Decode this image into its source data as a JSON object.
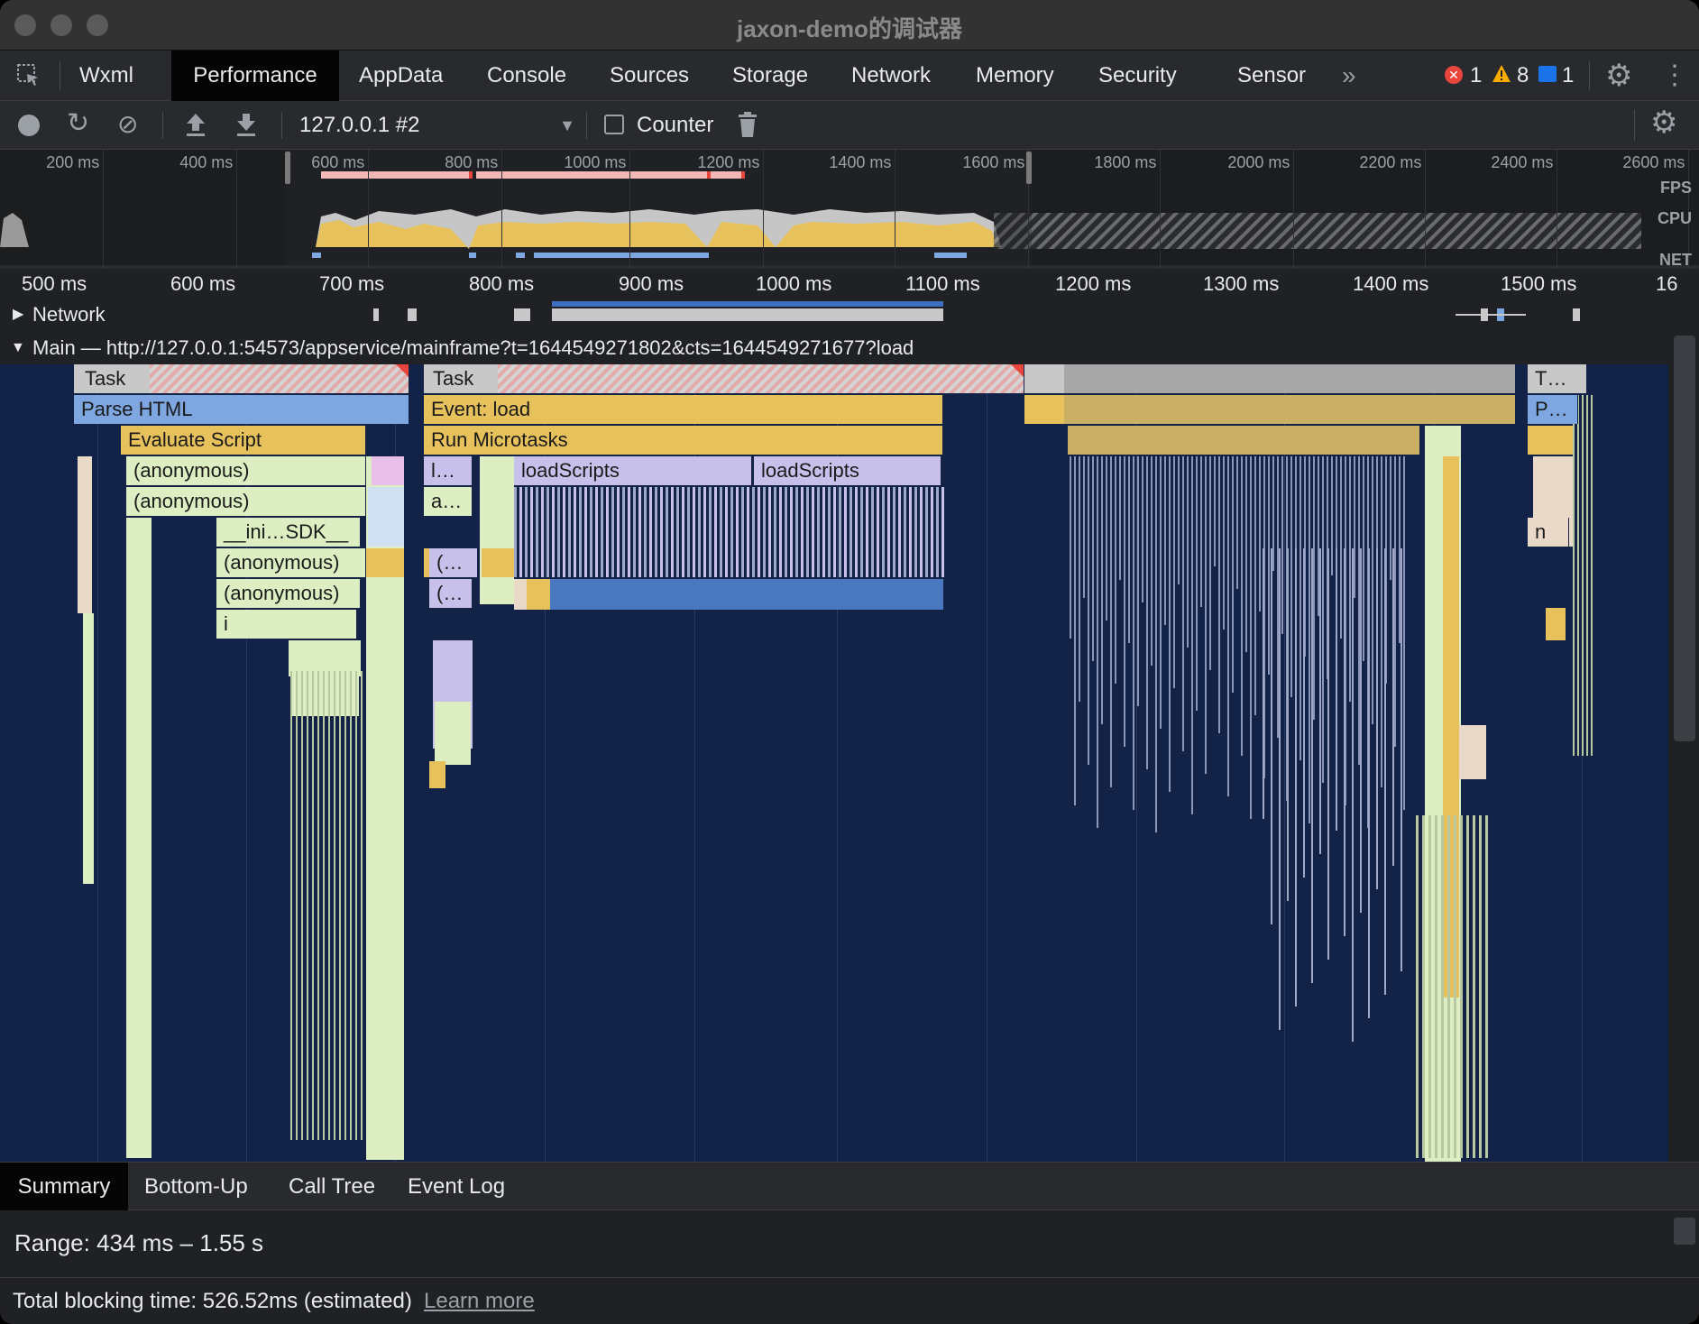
{
  "window": {
    "title": "jaxon-demo的调试器"
  },
  "tabs": [
    "Wxml",
    "Performance",
    "AppData",
    "Console",
    "Sources",
    "Storage",
    "Network",
    "Memory",
    "Security",
    "Sensor"
  ],
  "active_tab": "Performance",
  "more_tabs_label": "»",
  "counts": {
    "errors": "1",
    "warnings": "8",
    "messages": "1"
  },
  "toolbar": {
    "target": "127.0.0.1 #2",
    "counter_label": "Counter"
  },
  "overview": {
    "ticks": [
      "200 ms",
      "400 ms",
      "600 ms",
      "800 ms",
      "1000 ms",
      "1200 ms",
      "1400 ms",
      "1600 ms",
      "1800 ms",
      "2000 ms",
      "2200 ms",
      "2400 ms",
      "2600 ms"
    ],
    "fps_label": "FPS",
    "cpu_label": "CPU",
    "net_label": "NET"
  },
  "ruler": {
    "ticks": [
      "500 ms",
      "600 ms",
      "700 ms",
      "800 ms",
      "900 ms",
      "1000 ms",
      "1100 ms",
      "1200 ms",
      "1300 ms",
      "1400 ms",
      "1500 ms",
      "16"
    ]
  },
  "tracks": {
    "network_label": "Network",
    "main_label": "Main — http://127.0.0.1:54573/appservice/mainframe?t=1644549271802&cts=1644549271677?load"
  },
  "flame": {
    "task1": "Task",
    "task2": "Task",
    "task3": "T…",
    "parse_html": "Parse HTML",
    "event_load": "Event: load",
    "p_short": "P…",
    "evaluate_script": "Evaluate Script",
    "run_microtasks": "Run Microtasks",
    "anon1": "(anonymous)",
    "anon2": "(anonymous)",
    "anon3": "(anonymous)",
    "anon4": "(anonymous)",
    "init_sdk": "__ini…SDK__",
    "fn_i": "i",
    "l_short": "l…",
    "a_short": "a…",
    "paren1": "(…",
    "paren2": "(…",
    "load_scripts1": "loadScripts",
    "load_scripts2": "loadScripts",
    "fn_n": "n"
  },
  "bottom_tabs": [
    "Summary",
    "Bottom-Up",
    "Call Tree",
    "Event Log"
  ],
  "active_bottom_tab": "Summary",
  "summary": {
    "range": "Range: 434 ms – 1.55 s"
  },
  "footer": {
    "tbt": "Total blocking time: 526.52ms (estimated)",
    "learn_more": "Learn more"
  },
  "colors": {
    "flame_bg": "#132347",
    "task": "#c8c8c8",
    "parse_html": "#7ea6e0",
    "script": "#e7c25c",
    "anonymous": "#dceec2",
    "load_scripts": "#c6c0ea",
    "long_task_marker": "#e8453c",
    "cpu_scripting": "#e7c25c",
    "cpu_idle": "#c8c8c8"
  }
}
